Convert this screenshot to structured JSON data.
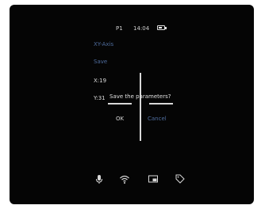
{
  "status_bar": {
    "profile": "P1",
    "time": "14:04",
    "battery_icon": "battery-icon",
    "battery_level": 0.7
  },
  "menu": {
    "items": [
      {
        "label": "XY-Axis",
        "color": "#4f6d9e"
      },
      {
        "label": "Save",
        "color": "#4f6d9e"
      },
      {
        "label": "X:19",
        "color": "#dcdcdc"
      },
      {
        "label": "Y:31",
        "color": "#dcdcdc"
      }
    ]
  },
  "dialog": {
    "message": "Save the parameters?",
    "ok_label": "OK",
    "cancel_label": "Cancel"
  },
  "bottom_bar": {
    "icons": [
      "microphone-icon",
      "wifi-icon",
      "picture-in-picture-icon",
      "tag-icon"
    ]
  },
  "colors": {
    "background": "#050505",
    "accent": "#4f6d9e",
    "text": "#d8d8d8"
  }
}
